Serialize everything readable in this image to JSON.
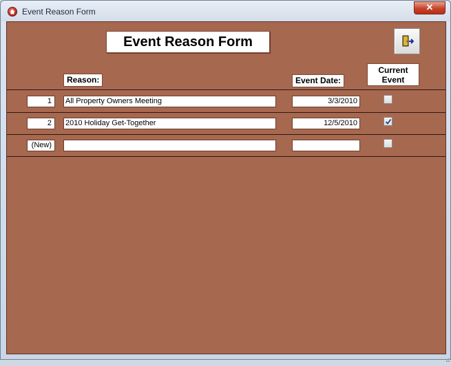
{
  "window": {
    "title": "Event Reason Form",
    "close_label": "✕",
    "app_icon": "access-home-icon"
  },
  "form": {
    "title": "Event Reason Form",
    "exit_icon": "exit-door-icon",
    "headers": {
      "reason": "Reason:",
      "event_date": "Event Date:",
      "current_event_line1": "Current",
      "current_event_line2": "Event"
    },
    "rows": [
      {
        "id": "1",
        "reason": "All Property Owners Meeting",
        "event_date": "3/3/2010",
        "current_event": false
      },
      {
        "id": "2",
        "reason": "2010 Holiday Get-Together",
        "event_date": "12/5/2010",
        "current_event": true
      },
      {
        "id": "(New)",
        "reason": "",
        "event_date": "",
        "current_event": false
      }
    ]
  },
  "colors": {
    "form_background": "#a76850",
    "row_separator": "#2a1710",
    "close_button": "#c7422a"
  }
}
